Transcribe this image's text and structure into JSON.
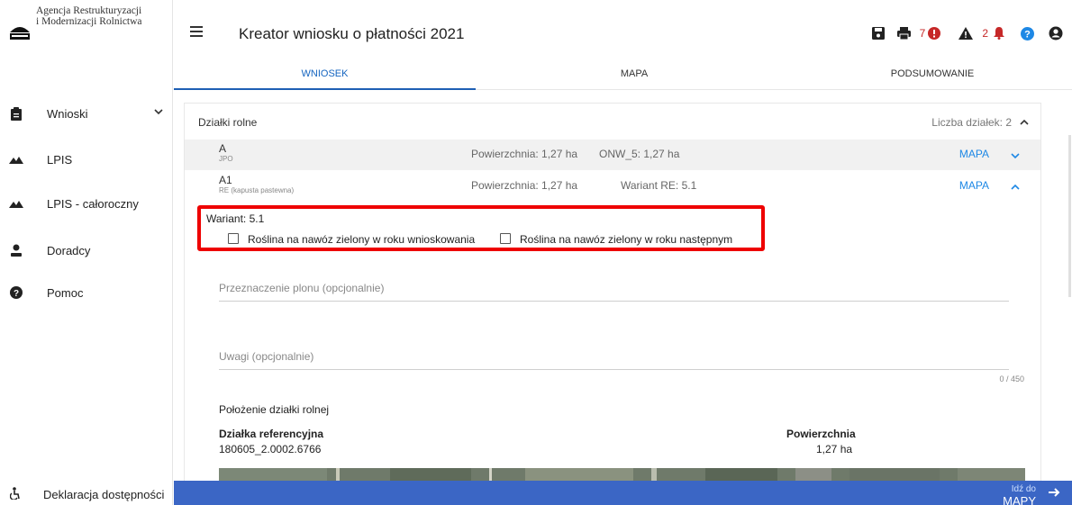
{
  "logo": {
    "line1": "Agencja Restrukturyzacji",
    "line2": "i Modernizacji Rolnictwa"
  },
  "sidebar": {
    "items": [
      {
        "label": "Wnioski",
        "icon": "clipboard-icon"
      },
      {
        "label": "LPIS",
        "icon": "mountains-icon"
      },
      {
        "label": "LPIS - całoroczny",
        "icon": "mountains-icon"
      },
      {
        "label": "Doradcy",
        "icon": "person-icon"
      },
      {
        "label": "Pomoc",
        "icon": "help-icon"
      }
    ],
    "footer_label": "Deklaracja dostępności"
  },
  "header": {
    "title": "Kreator wniosku o płatności 2021",
    "error_count": "7",
    "warning_count": "2"
  },
  "tabs": [
    {
      "label": "WNIOSEK",
      "active": true
    },
    {
      "label": "MAPA",
      "active": false
    },
    {
      "label": "PODSUMOWANIE",
      "active": false
    }
  ],
  "section": {
    "title": "Działki rolne",
    "count_label": "Liczba działek: 2"
  },
  "parcels": [
    {
      "id": "A",
      "sub": "JPO",
      "area": "Powierzchnia: 1,27 ha",
      "extra": "ONW_5: 1,27 ha",
      "map": "MAPA"
    },
    {
      "id": "A1",
      "sub": "RE (kapusta pastewna)",
      "area": "Powierzchnia: 1,27 ha",
      "extra": "Wariant RE: 5.1",
      "map": "MAPA"
    }
  ],
  "variant": {
    "label": "Wariant: 5.1",
    "checkbox1": "Roślina na nawóz zielony w roku wnioskowania",
    "checkbox2": "Roślina na nawóz zielony w roku następnym"
  },
  "fields": {
    "purpose_placeholder": "Przeznaczenie plonu (opcjonalnie)",
    "notes_placeholder": "Uwagi (opcjonalnie)",
    "notes_counter": "0 / 450"
  },
  "location": {
    "title": "Położenie działki rolnej",
    "col_ref": "Działka referencyjna",
    "col_area": "Powierzchnia",
    "ref_value": "180605_2.0002.6766",
    "area_value": "1,27 ha"
  },
  "bottom": {
    "next_small": "Idź do",
    "next_big": "MAPY"
  },
  "colors": {
    "accent": "#1e5fb4",
    "link": "#1e88e5",
    "highlight": "#ee0000",
    "bar": "#3b66c5"
  }
}
